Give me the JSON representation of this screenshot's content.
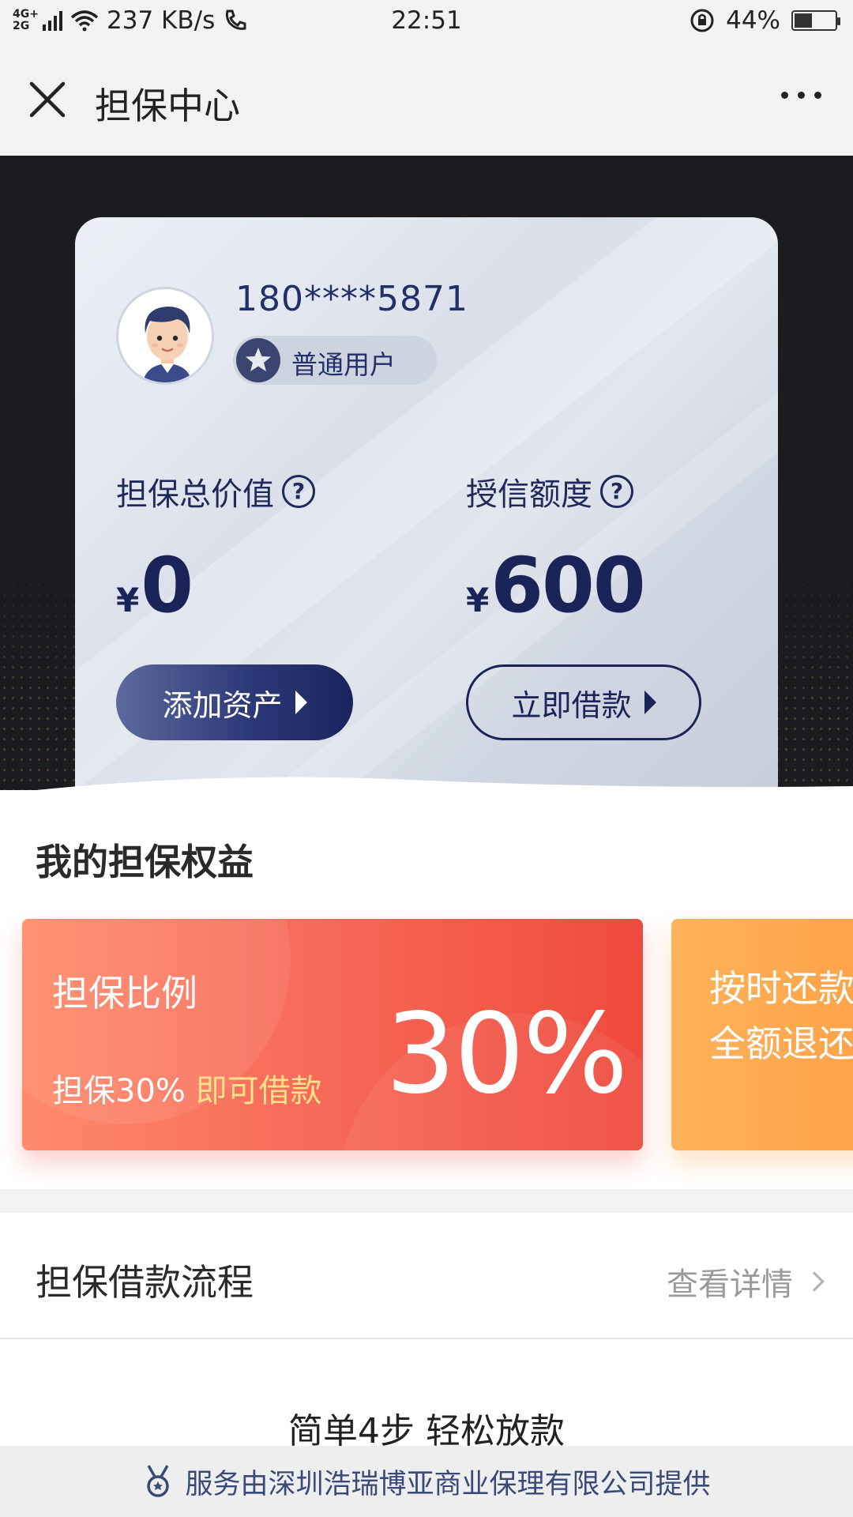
{
  "status_bar": {
    "network_type": "4G+ 2G",
    "speed": "237 KB/s",
    "time": "22:51",
    "battery_percent": "44%",
    "battery_level": 0.44
  },
  "nav": {
    "title": "担保中心"
  },
  "user": {
    "phone": "180****5871",
    "level": "普通用户"
  },
  "metrics": {
    "guarantee": {
      "label": "担保总价值",
      "currency": "¥",
      "value": "0"
    },
    "credit": {
      "label": "授信额度",
      "currency": "¥",
      "value": "600"
    }
  },
  "actions": {
    "add_assets": "添加资产",
    "borrow_now": "立即借款"
  },
  "benefits": {
    "title": "我的担保权益",
    "ratio_card": {
      "title": "担保比例",
      "sub_prefix": "担保30%",
      "sub_highlight": "即可借款",
      "value": "30%"
    },
    "refund_card": {
      "line1": "按时还款",
      "line2": "全额退还"
    }
  },
  "process": {
    "title": "担保借款流程",
    "link": "查看详情",
    "steps_title": "简单4步 轻松放款"
  },
  "footer": {
    "text": "服务由深圳浩瑞博亚商业保理有限公司提供"
  },
  "colors": {
    "navy": "#1b2459",
    "red_card": "#ef4a3d",
    "orange_card": "#ff9f45",
    "highlight": "#ffe18a"
  }
}
